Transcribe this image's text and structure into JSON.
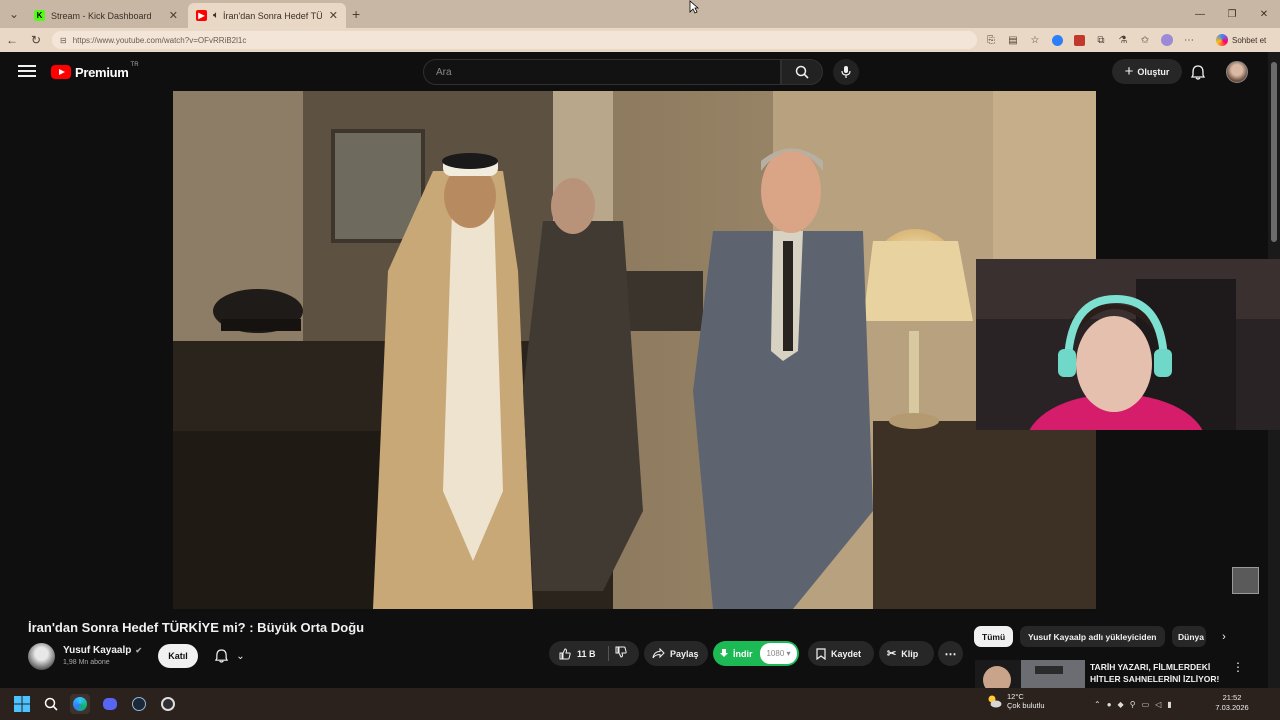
{
  "browser": {
    "tabs": [
      {
        "label": "Stream - Kick Dashboard",
        "favicon": "kick-icon",
        "active": false
      },
      {
        "label": "İran'dan Sonra Hedef TÜRKİYE mi",
        "favicon": "youtube-icon",
        "active": true,
        "audio": true
      }
    ],
    "url": "https://www.youtube.com/watch?v=OFvRRiB2l1c",
    "copilot_label": "Sohbet et",
    "accent_color": "#ead8c6"
  },
  "youtube": {
    "logo_text": "Premium",
    "country_code": "TR",
    "search_placeholder": "Ara",
    "create_label": "Oluştur"
  },
  "video": {
    "title": "İran'dan Sonra Hedef TÜRKİYE mi? : Büyük Orta Doğu",
    "channel": "Yusuf Kayaalp",
    "subscribers": "1,98 Mn abone",
    "join_label": "Katıl",
    "likes": "11 B",
    "share_label": "Paylaş",
    "download_label": "İndir",
    "download_quality": "1080",
    "save_label": "Kaydet",
    "clip_label": "Klip"
  },
  "sidebar": {
    "chips": [
      "Tümü",
      "Yusuf Kayaalp adlı yükleyiciden",
      "Dünya"
    ],
    "recommendation_title": "TARİH YAZARI, FİLMLERDEKİ HİTLER SAHNELERİNİ İZLİYOR!"
  },
  "taskbar": {
    "weather_temp": "12°C",
    "weather_desc": "Çok bulutlu",
    "time": "21:52",
    "date": "7.03.2026"
  }
}
